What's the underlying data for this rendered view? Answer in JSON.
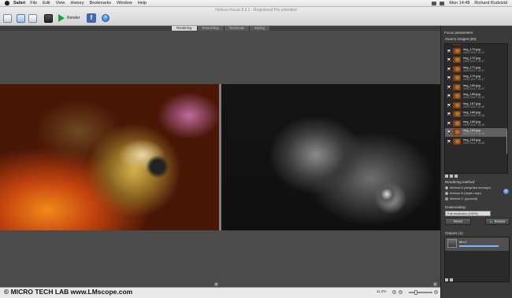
{
  "menubar": {
    "app": "Safari",
    "items": [
      "File",
      "Edit",
      "View",
      "History",
      "Bookmarks",
      "Window",
      "Help"
    ],
    "clock": "Mon 14:48",
    "user": "Richard Rudzizid"
  },
  "window": {
    "title": "Helicon Focus 8.3.1 - Registered Pro unlimited"
  },
  "toolbar": {
    "render_label": "Render",
    "help_glyph": "?",
    "fb_glyph": "f"
  },
  "tabs": [
    {
      "label": "Rendering",
      "active": true
    },
    {
      "label": "Retouching",
      "active": false
    },
    {
      "label": "Text/Scale",
      "active": false
    },
    {
      "label": "Saving",
      "active": false
    }
  ],
  "panel": {
    "title": "Focus parameters",
    "source_images_label": "Source images (60):",
    "rendering_method_label": "Rendering method:",
    "methods": [
      {
        "label": "Method A (weighted average)",
        "selected": false
      },
      {
        "label": "Method B (depth map)",
        "selected": false
      },
      {
        "label": "Method C (pyramid)",
        "selected": true
      }
    ],
    "downscaling_label": "Downscaling:",
    "downscaling_value": "Full resolution (100%)",
    "reset_label": "Reset",
    "render_label": "Render",
    "outputs_label": "Outputs (1):",
    "output_name": "Mn-C",
    "help_glyph": "?"
  },
  "source_images": [
    {
      "name": "img_174.jpg",
      "date": "26/07/2017 15:48",
      "selected": false
    },
    {
      "name": "img_173.jpg",
      "date": "26/07/2017 15:47",
      "selected": false
    },
    {
      "name": "img_172.jpg",
      "date": "26/07/2017 15:47",
      "selected": false
    },
    {
      "name": "img_171.jpg",
      "date": "26/07/2017 15:47",
      "selected": false
    },
    {
      "name": "img_170.jpg",
      "date": "26/07/2017 15:47",
      "selected": false
    },
    {
      "name": "img_169.jpg",
      "date": "26/07/2017 15:47",
      "selected": false
    },
    {
      "name": "img_168.jpg",
      "date": "26/07/2017 15:47",
      "selected": false
    },
    {
      "name": "img_167.jpg",
      "date": "26/07/2017 15:46",
      "selected": false
    },
    {
      "name": "img_166.jpg",
      "date": "26/07/2017 15:46",
      "selected": false
    },
    {
      "name": "img_165.jpg",
      "date": "26/07/2017 15:46",
      "selected": false
    },
    {
      "name": "img_164.jpg",
      "date": "26/07/2017 15:46",
      "selected": true
    },
    {
      "name": "img_163.jpg",
      "date": "26/07/2017 15:46",
      "selected": false
    }
  ],
  "status": {
    "zoom": "11.2%"
  },
  "watermark": "©  MICRO TECH LAB    www.LMscope.com",
  "colors": {
    "render_green": "#1ea33a",
    "panel_bg": "#3a3a3a",
    "viewer_bg": "#4b4b4b"
  }
}
